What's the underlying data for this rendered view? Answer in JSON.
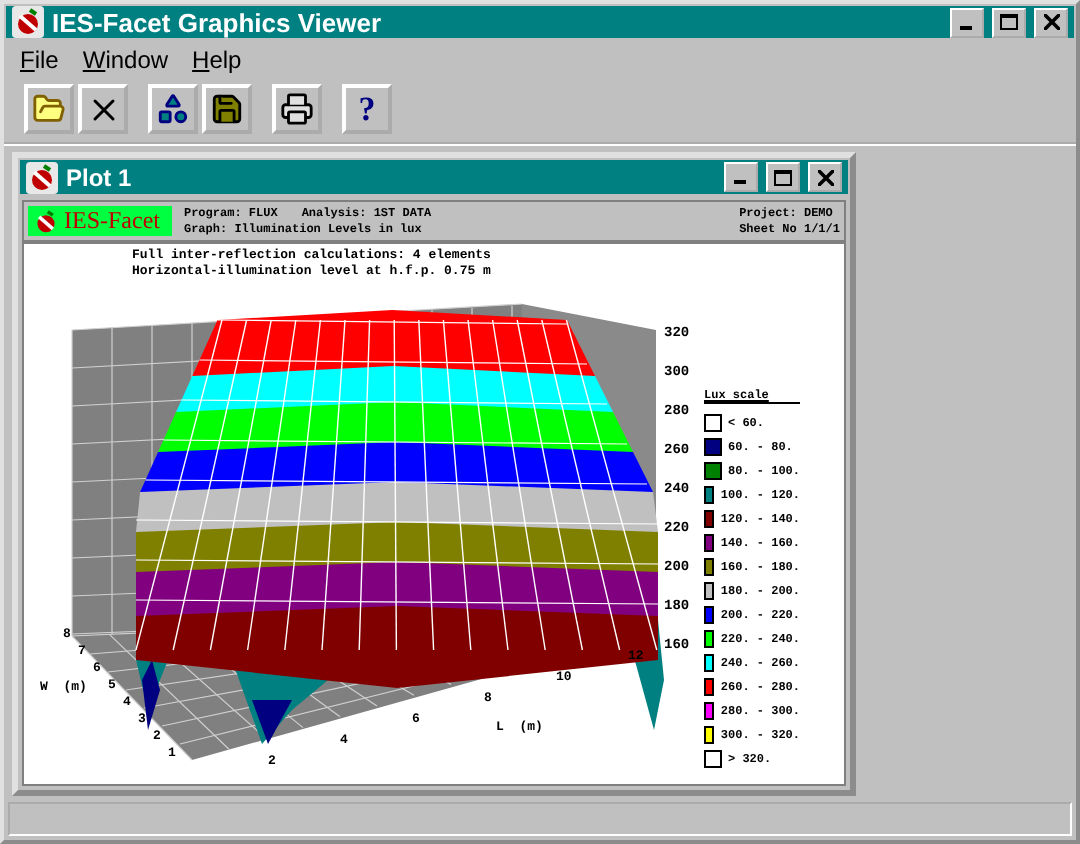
{
  "window": {
    "title": "IES-Facet Graphics Viewer"
  },
  "menu": [
    {
      "label": "File"
    },
    {
      "label": "Window"
    },
    {
      "label": "Help"
    }
  ],
  "toolbar": [
    {
      "kind": "open"
    },
    {
      "kind": "close"
    },
    {
      "kind": "shapes"
    },
    {
      "kind": "save"
    },
    {
      "kind": "print"
    },
    {
      "kind": "help",
      "label": "?"
    }
  ],
  "plot_window": {
    "title": "Plot 1",
    "logo": "IES-Facet",
    "header": [
      {
        "label": "Program:",
        "value": "FLUX"
      },
      {
        "label": "Analysis:",
        "value": "1ST DATA"
      },
      {
        "label": "Project:",
        "value": "DEMO"
      },
      {
        "label": "Graph:",
        "value": "Illumination Levels in lux"
      },
      {
        "label": "Sheet No",
        "value": "1/1/1"
      }
    ],
    "notes": [
      "Full inter-reflection calculations:  4 elements",
      "Horizontal-illumination level at h.f.p. 0.75 m"
    ],
    "z_ticks": [
      "320",
      "300",
      "280",
      "260",
      "240",
      "220",
      "200",
      "180",
      "160"
    ],
    "w_ticks": [
      "1",
      "2",
      "3",
      "4",
      "5",
      "6",
      "7",
      "8"
    ],
    "l_ticks": [
      "2",
      "4",
      "6",
      "8",
      "10",
      "12"
    ],
    "w_label": "W  (m)",
    "l_label": "L  (m)",
    "legend": {
      "title": "Lux scale",
      "items": [
        {
          "label": "< 60.",
          "color": "#ffffff"
        },
        {
          "label": "60. - 80.",
          "color": "#000080"
        },
        {
          "label": "80. - 100.",
          "color": "#008000"
        },
        {
          "label": "100. - 120.",
          "color": "#008080"
        },
        {
          "label": "120. - 140.",
          "color": "#800000"
        },
        {
          "label": "140. - 160.",
          "color": "#800080"
        },
        {
          "label": "160. - 180.",
          "color": "#808000"
        },
        {
          "label": "180. - 200.",
          "color": "#c0c0c0"
        },
        {
          "label": "200. - 220.",
          "color": "#0000ff"
        },
        {
          "label": "220. - 240.",
          "color": "#00ff00"
        },
        {
          "label": "240. - 260.",
          "color": "#00ffff"
        },
        {
          "label": "260. - 280.",
          "color": "#ff0000"
        },
        {
          "label": "280. - 300.",
          "color": "#ff00ff"
        },
        {
          "label": "300. - 320.",
          "color": "#ffff00"
        },
        {
          "label": "> 320.",
          "color": "#ffffff"
        }
      ]
    }
  }
}
